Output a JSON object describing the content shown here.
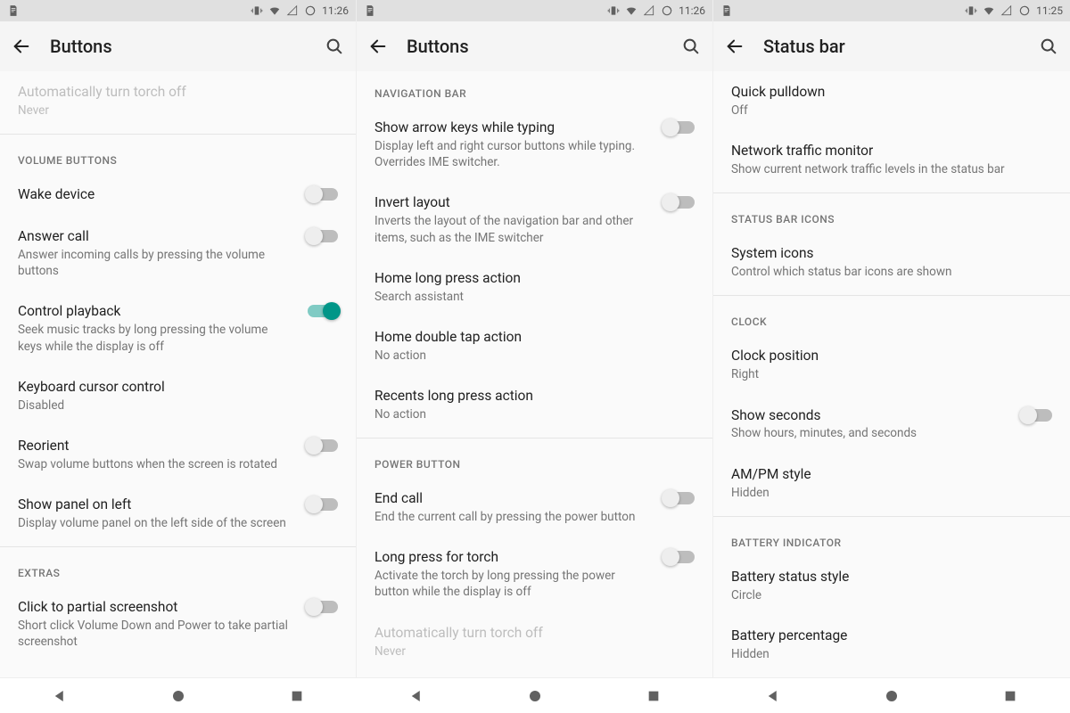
{
  "panels": [
    {
      "statusbar": {
        "time": "11:26"
      },
      "appbar": {
        "title": "Buttons"
      },
      "groups": [
        {
          "header": null,
          "items": [
            {
              "title": "Automatically turn torch off",
              "sub": "Never",
              "switch": null,
              "disabled": true
            }
          ]
        },
        {
          "header": "VOLUME BUTTONS",
          "items": [
            {
              "title": "Wake device",
              "sub": null,
              "switch": false
            },
            {
              "title": "Answer call",
              "sub": "Answer incoming calls by pressing the volume buttons",
              "switch": false
            },
            {
              "title": "Control playback",
              "sub": "Seek music tracks by long pressing the volume keys while the display is off",
              "switch": true
            },
            {
              "title": "Keyboard cursor control",
              "sub": "Disabled",
              "switch": null
            },
            {
              "title": "Reorient",
              "sub": "Swap volume buttons when the screen is rotated",
              "switch": false
            },
            {
              "title": "Show panel on left",
              "sub": "Display volume panel on the left side of the screen",
              "switch": false
            }
          ]
        },
        {
          "header": "EXTRAS",
          "items": [
            {
              "title": "Click to partial screenshot",
              "sub": "Short click Volume Down and Power to take partial screenshot",
              "switch": false
            }
          ]
        }
      ]
    },
    {
      "statusbar": {
        "time": "11:26"
      },
      "appbar": {
        "title": "Buttons"
      },
      "groups": [
        {
          "header": "NAVIGATION BAR",
          "items": [
            {
              "title": "Show arrow keys while typing",
              "sub": "Display left and right cursor buttons while typing. Overrides IME switcher.",
              "switch": false
            },
            {
              "title": "Invert layout",
              "sub": "Inverts the layout of the navigation bar and other items, such as the IME switcher",
              "switch": false
            },
            {
              "title": "Home long press action",
              "sub": "Search assistant",
              "switch": null
            },
            {
              "title": "Home double tap action",
              "sub": "No action",
              "switch": null
            },
            {
              "title": "Recents long press action",
              "sub": "No action",
              "switch": null
            }
          ]
        },
        {
          "header": "POWER BUTTON",
          "items": [
            {
              "title": "End call",
              "sub": "End the current call by pressing the power button",
              "switch": false
            },
            {
              "title": "Long press for torch",
              "sub": "Activate the torch by long pressing the power button while the display is off",
              "switch": false
            },
            {
              "title": "Automatically turn torch off",
              "sub": "Never",
              "switch": null,
              "disabled": true
            }
          ]
        }
      ]
    },
    {
      "statusbar": {
        "time": "11:25"
      },
      "appbar": {
        "title": "Status bar"
      },
      "groups": [
        {
          "header": null,
          "items": [
            {
              "title": "Quick pulldown",
              "sub": "Off",
              "switch": null
            },
            {
              "title": "Network traffic monitor",
              "sub": "Show current network traffic levels in the status bar",
              "switch": null
            }
          ]
        },
        {
          "header": "STATUS BAR ICONS",
          "items": [
            {
              "title": "System icons",
              "sub": "Control which status bar icons are shown",
              "switch": null
            }
          ]
        },
        {
          "header": "CLOCK",
          "items": [
            {
              "title": "Clock position",
              "sub": "Right",
              "switch": null
            },
            {
              "title": "Show seconds",
              "sub": "Show hours, minutes, and seconds",
              "switch": false
            },
            {
              "title": "AM/PM style",
              "sub": "Hidden",
              "switch": null
            }
          ]
        },
        {
          "header": "BATTERY INDICATOR",
          "items": [
            {
              "title": "Battery status style",
              "sub": "Circle",
              "switch": null
            },
            {
              "title": "Battery percentage",
              "sub": "Hidden",
              "switch": null
            }
          ]
        }
      ]
    }
  ]
}
